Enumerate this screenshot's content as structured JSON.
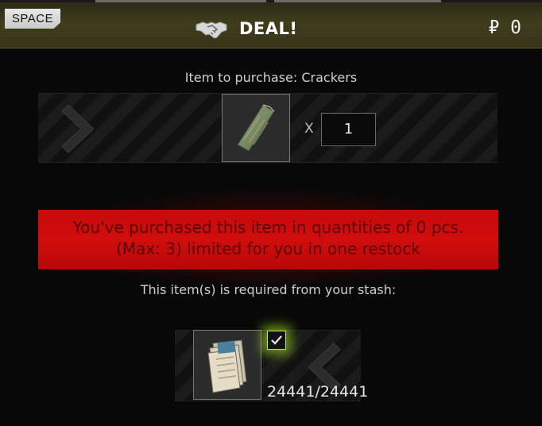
{
  "header": {
    "hotkey": "SPACE",
    "title": "DEAL!",
    "price": "₽ 0",
    "handshake_icon": "handshake-icon"
  },
  "purchase": {
    "label": "Item to purchase: Crackers",
    "item_icon": "crackers-icon",
    "qty_prefix": "X",
    "quantity": "1"
  },
  "warning": {
    "line1": "You've purchased this item in quantities of 0 pcs.",
    "line2": "(Max: 3) limited for you in one restock",
    "color": "#c80a0a"
  },
  "requirements": {
    "label": "This item(s) is required from your stash:",
    "item_icon": "roubles-icon",
    "checked": true,
    "count": "24441/24441",
    "check_color": "#bfe44a"
  }
}
